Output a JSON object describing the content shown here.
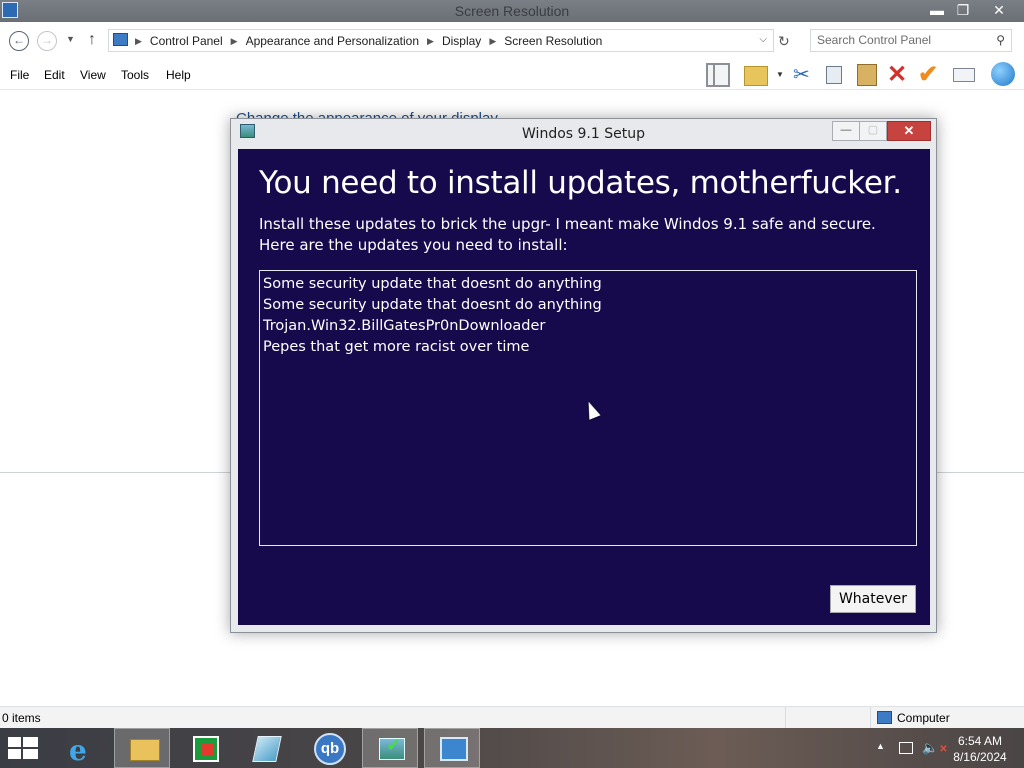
{
  "window": {
    "title": "Screen Resolution",
    "controls": {
      "minimize": "▬",
      "maximize": "❐",
      "close": "✕"
    }
  },
  "nav": {
    "back": "←",
    "forward": "→",
    "dropdown": "▼",
    "up": "↑",
    "breadcrumbs": [
      "Control Panel",
      "Appearance and Personalization",
      "Display",
      "Screen Resolution"
    ],
    "separator": "▶",
    "address_dropdown": "⌵",
    "refresh": "↻",
    "search_placeholder": "Search Control Panel",
    "search_icon": "⚲"
  },
  "menu": [
    "File",
    "Edit",
    "View",
    "Tools",
    "Help"
  ],
  "toolbar_icons": [
    "layout-icon",
    "folder-options-icon",
    "cut-icon",
    "copy-icon",
    "paste-icon",
    "delete-icon",
    "checkmark-icon",
    "properties-icon",
    "globe-icon"
  ],
  "toolbar_glyphs": {
    "cut": "✂",
    "delete": "✕",
    "check": "✔",
    "folder_drop": "▼"
  },
  "background": {
    "heading": "Change the appearance of your display"
  },
  "statusbar": {
    "items": "0 items",
    "location": "Computer"
  },
  "dialog": {
    "title": "Windos 9.1 Setup",
    "controls": {
      "minimize": "—",
      "maximize": "▢",
      "close": "✕"
    },
    "headline": "You need to install updates, motherfucker.",
    "desc_line1": "Install these updates to brick the upgr- I meant make Windos 9.1 safe and secure.",
    "desc_line2": "Here are the updates you need to install:",
    "updates": [
      "Some security update that doesnt do anything",
      "Some security update that doesnt do anything",
      "Trojan.Win32.BillGatesPr0nDownloader",
      "Pepes that get more racist over time"
    ],
    "button": "Whatever"
  },
  "taskbar": {
    "apps": [
      "start-icon",
      "internet-explorer-icon",
      "file-explorer-icon",
      "store-icon",
      "document-icon",
      "qbittorrent-icon",
      "setup-icon",
      "screen-resolution-icon"
    ],
    "ie_glyph": "e",
    "qb_glyph": "qb",
    "tray": {
      "up": "▲",
      "volume": "🔈",
      "volume_mute": "✕"
    },
    "time": "6:54 AM",
    "date": "8/16/2024"
  },
  "colors": {
    "dialog_background": "#16094c",
    "close_button": "#c7433f",
    "accent_link": "#1f4e8f"
  }
}
